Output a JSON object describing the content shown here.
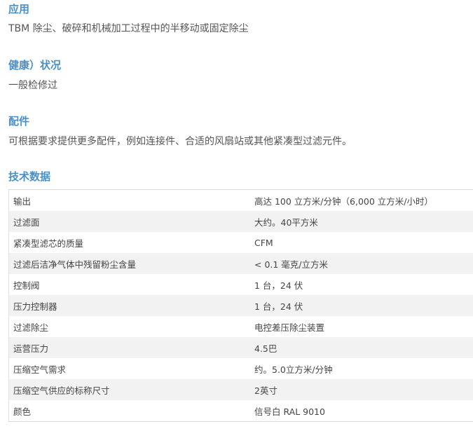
{
  "sections": [
    {
      "heading": "应用",
      "text": "TBM 除尘、破碎和机械加工过程中的半移动或固定除尘"
    },
    {
      "heading": "健康）状况",
      "text": "一般检修过"
    },
    {
      "heading": "配件",
      "text": "可根据要求提供更多配件，例如连接件、合适的风扇站或其他紧凑型过滤元件。"
    },
    {
      "heading": "技术数据"
    }
  ],
  "spec_table": {
    "rows": [
      {
        "key": "输出",
        "value": "高达 100 立方米/分钟（6,000 立方米/小时）"
      },
      {
        "key": "过滤面",
        "value": "大约。40平方米"
      },
      {
        "key": "紧凑型滤芯的质量",
        "value": "CFM"
      },
      {
        "key": "过滤后洁净气体中残留粉尘含量",
        "value": "< 0.1 毫克/立方米"
      },
      {
        "key": "控制阀",
        "value": "1 台，24 伏"
      },
      {
        "key": "压力控制器",
        "value": "1 台，24 伏"
      },
      {
        "key": "过滤除尘",
        "value": "电控差压除尘装置"
      },
      {
        "key": "运营压力",
        "value": "4.5巴"
      },
      {
        "key": "压缩空气需求",
        "value": "约。5.0立方米/分钟"
      },
      {
        "key": "压缩空气供应的标称尺寸",
        "value": "2英寸"
      },
      {
        "key": "颜色",
        "value": "信号白 RAL 9010"
      }
    ]
  },
  "colors": {
    "heading": "#4a90c8",
    "text": "#555555",
    "row_alt": "#f2f2f2"
  }
}
